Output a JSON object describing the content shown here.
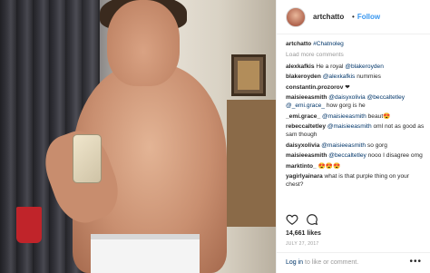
{
  "photo": {
    "alt_icon": "selfie-photo"
  },
  "header": {
    "username": "artchatto",
    "separator": "•",
    "follow_label": "Follow"
  },
  "caption": {
    "user": "artchatto",
    "text": "#Chatnoleg"
  },
  "load_more": "Load more comments",
  "comments": [
    {
      "user": "alexkafkis",
      "text": "He a royal ",
      "mention": "@blakeroyden",
      "text2": ""
    },
    {
      "user": "blakeroyden",
      "text": "",
      "mention": "@alexkafkis",
      "text2": " nummies"
    },
    {
      "user": "constantin.prozorov",
      "text": "",
      "mention": "",
      "text2": " ❤"
    },
    {
      "user": "maisieeasmith",
      "text": "",
      "mention": "@daisyxolivia @beccaltetley @_emi.grace_",
      "text2": " how gorg is he"
    },
    {
      "user": "_emi.grace_",
      "text": "",
      "mention": "@maisieeasmith",
      "text2": " beaut😍"
    },
    {
      "user": "rebeccaltetley",
      "text": "",
      "mention": "@maisieeasmith",
      "text2": " oml not as good as sam though"
    },
    {
      "user": "daisyxolivia",
      "text": "",
      "mention": "@maisieeasmith",
      "text2": " so gorg"
    },
    {
      "user": "maisieeasmith",
      "text": "",
      "mention": "@beccaltetley",
      "text2": " nooo I disagree omg"
    },
    {
      "user": "marktinto_",
      "text": "",
      "mention": "",
      "text2": " 😍😍😍"
    },
    {
      "user": "yagirlyainara",
      "text": "",
      "mention": "",
      "text2": " what is that purple thing on your chest?"
    }
  ],
  "likes": "14,661 likes",
  "date": "JULY 27, 2017",
  "footer": {
    "login_text": "Log in",
    "login_rest": " to like or comment.",
    "more": "•••"
  },
  "icons": {
    "heart": "heart-icon",
    "comment": "comment-icon",
    "more": "more-icon"
  },
  "colors": {
    "link": "#003569",
    "follow": "#3897f0",
    "muted": "#999999"
  }
}
